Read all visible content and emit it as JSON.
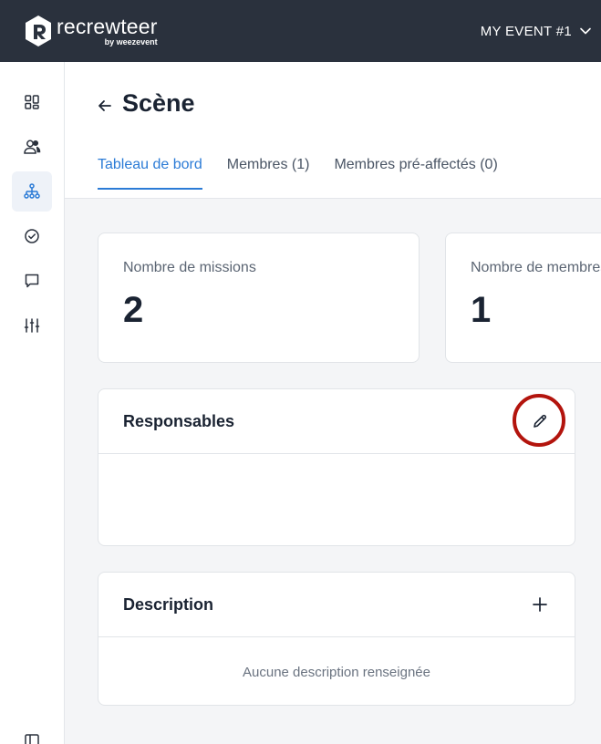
{
  "app": {
    "logo_name": "recrewteer",
    "logo_sub": "by weezevent"
  },
  "header": {
    "event_label": "MY EVENT #1"
  },
  "sidebar": {
    "items": [
      {
        "icon": "dashboard-grid-icon"
      },
      {
        "icon": "users-icon"
      },
      {
        "icon": "org-chart-icon",
        "active": true
      },
      {
        "icon": "check-circle-icon"
      },
      {
        "icon": "chat-bubble-icon"
      },
      {
        "icon": "sliders-icon"
      },
      {
        "icon": "sidebar-toggle-icon"
      }
    ]
  },
  "page": {
    "title": "Scène",
    "tabs": [
      {
        "label": "Tableau de bord",
        "active": true
      },
      {
        "label": "Membres (1)"
      },
      {
        "label": "Membres pré-affectés (0)"
      }
    ]
  },
  "stats": [
    {
      "label": "Nombre de missions",
      "value": "2"
    },
    {
      "label": "Nombre de membres",
      "value": "1"
    }
  ],
  "responsables": {
    "title": "Responsables"
  },
  "description": {
    "title": "Description",
    "empty_text": "Aucune description renseignée"
  },
  "colors": {
    "topbar": "#2a313d",
    "accent": "#2b7bd6",
    "highlight": "#b3140d"
  }
}
